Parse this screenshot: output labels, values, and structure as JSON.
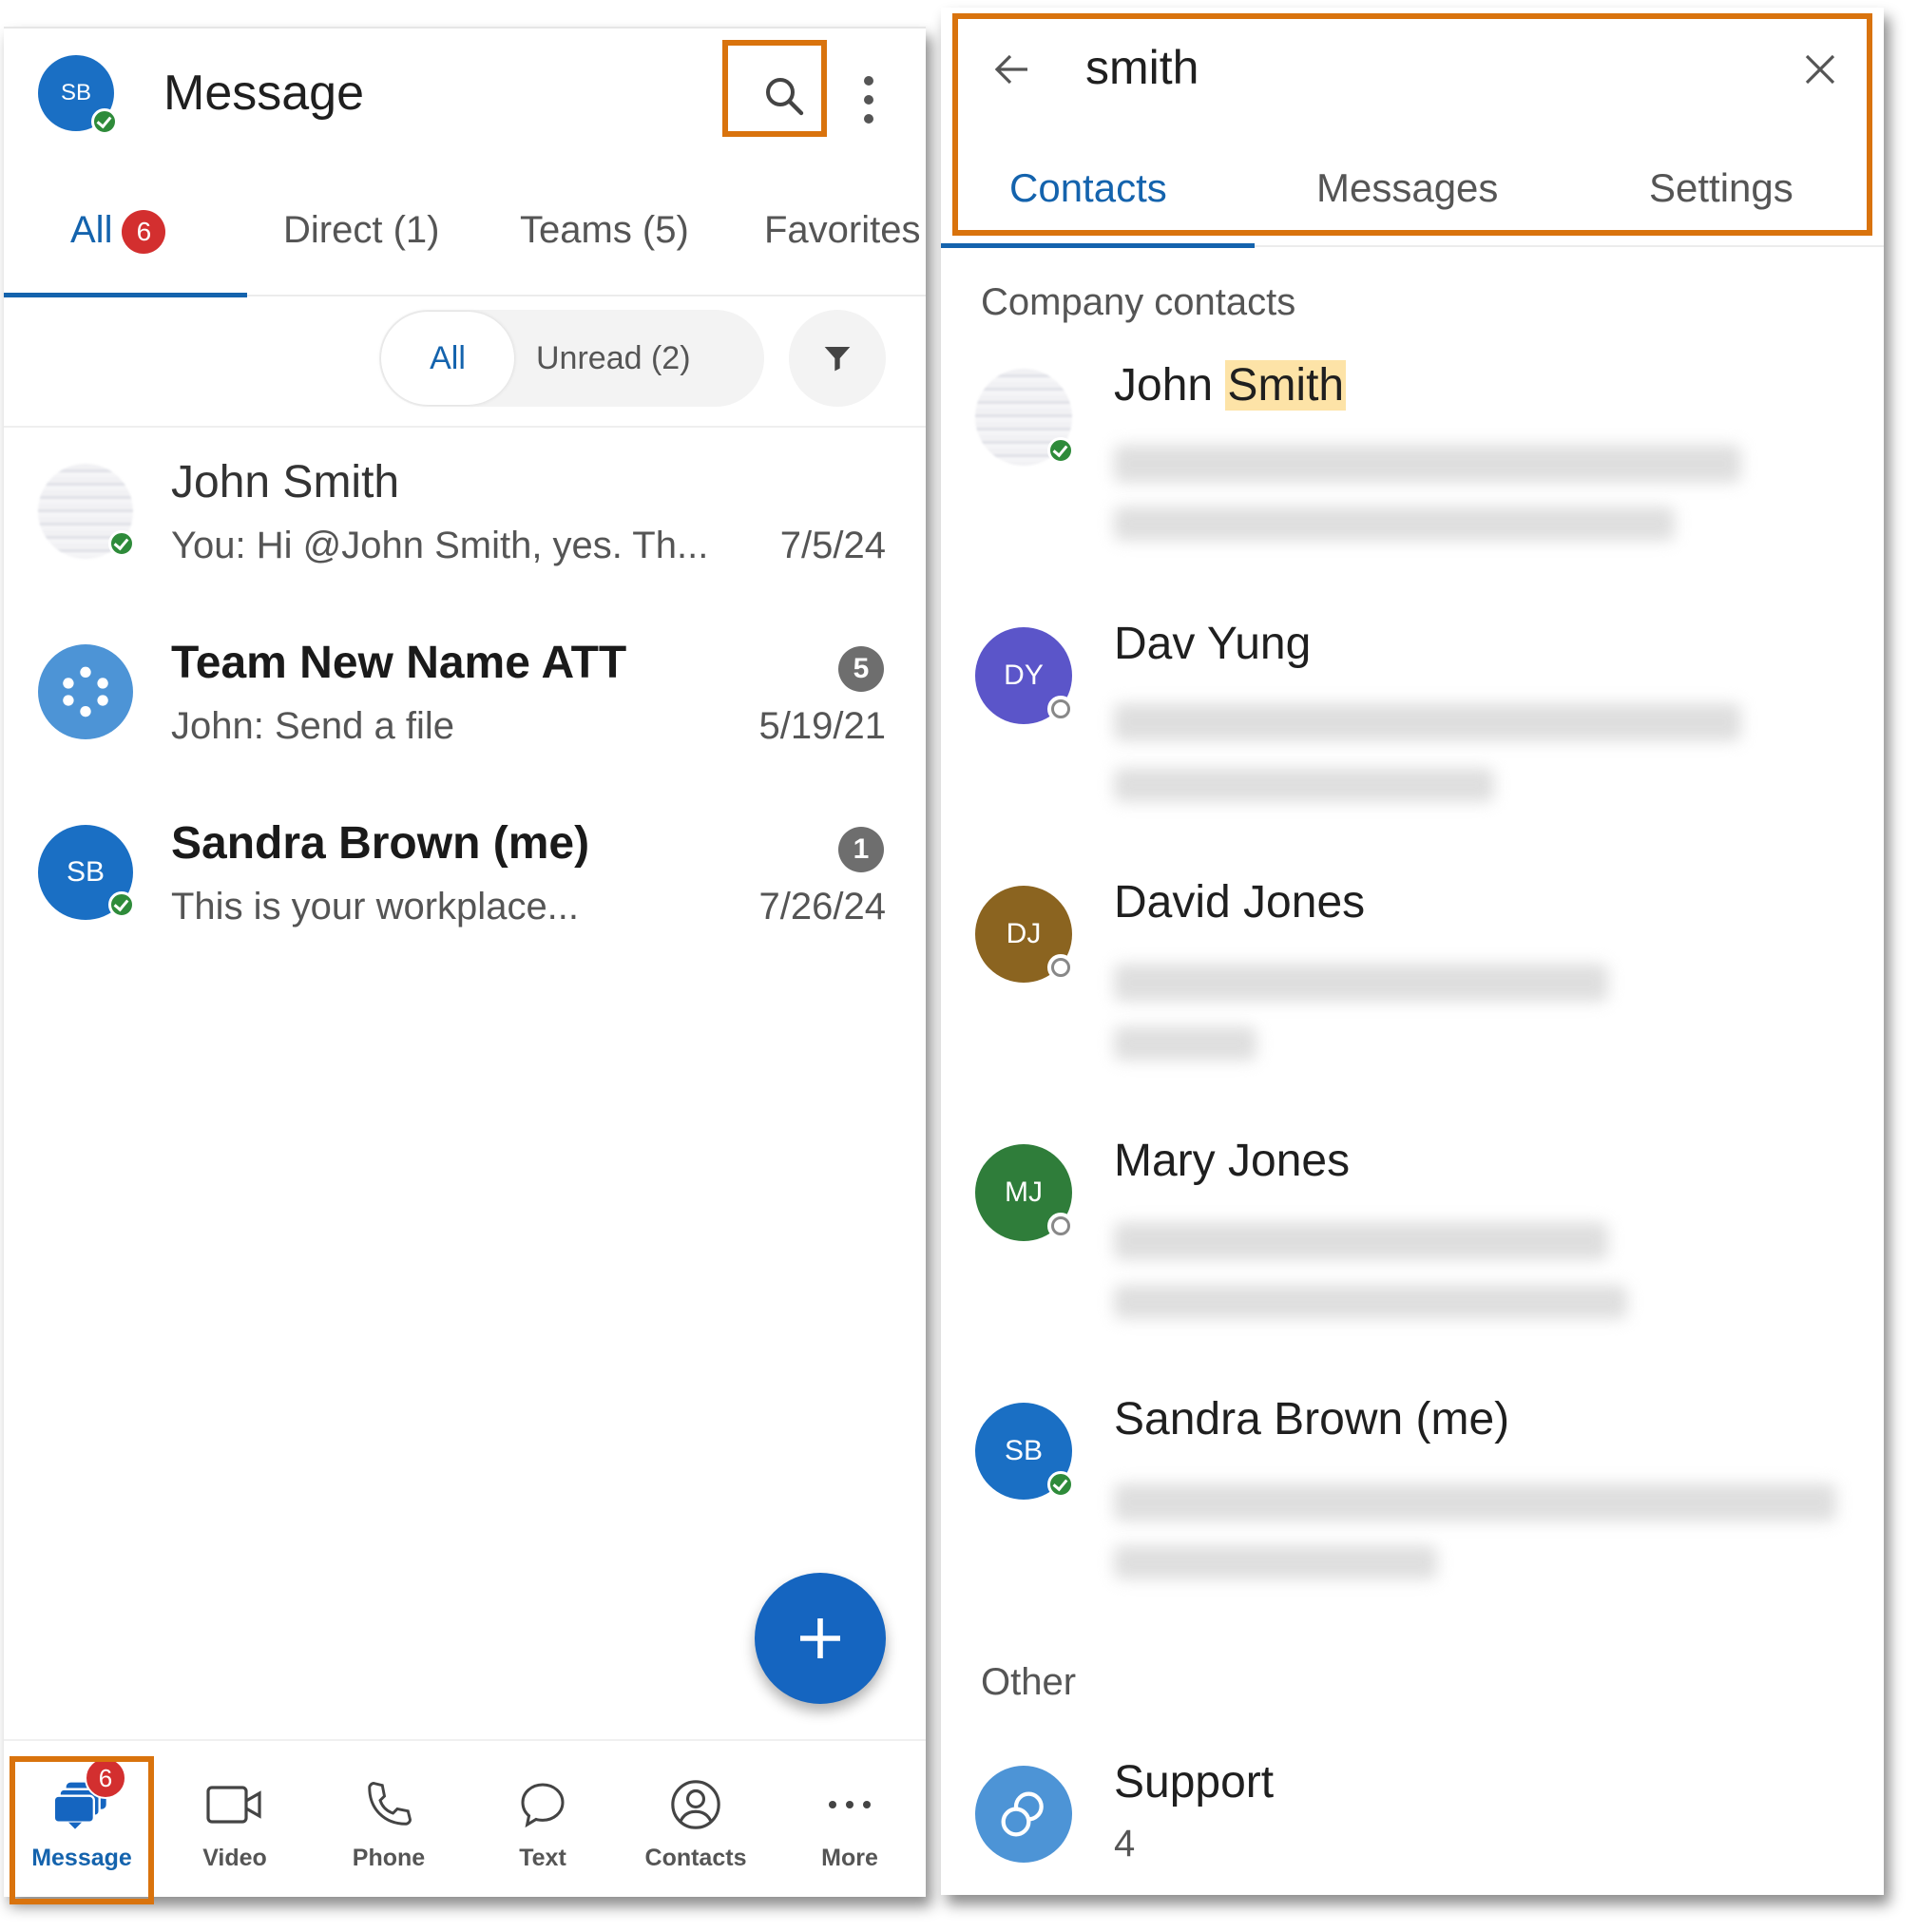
{
  "left_panel": {
    "user_avatar_initials": "SB",
    "title": "Message",
    "tabs": [
      {
        "label": "All",
        "badge": "6",
        "active": true
      },
      {
        "label": "Direct (1)"
      },
      {
        "label": "Teams (5)"
      },
      {
        "label": "Favorites"
      }
    ],
    "filter": {
      "all_label": "All",
      "unread_label": "Unread (2)"
    },
    "conversations": [
      {
        "name": "John Smith",
        "preview": "You: Hi @John Smith, yes. Th...",
        "date": "7/5/24",
        "bold": false,
        "status": "online"
      },
      {
        "name": "Team New Name ATT",
        "preview": "John: Send a file",
        "date": "5/19/21",
        "unread": "5",
        "bold": true
      },
      {
        "name": "Sandra Brown (me)",
        "initials": "SB",
        "preview": "This is your workplace...",
        "date": "7/26/24",
        "unread": "1",
        "bold": true,
        "status": "online"
      }
    ],
    "bottom_nav": [
      {
        "label": "Message",
        "icon": "message-icon",
        "badge": "6",
        "active": true
      },
      {
        "label": "Video",
        "icon": "video-icon"
      },
      {
        "label": "Phone",
        "icon": "phone-icon"
      },
      {
        "label": "Text",
        "icon": "text-icon"
      },
      {
        "label": "Contacts",
        "icon": "contacts-icon"
      },
      {
        "label": "More",
        "icon": "more-icon"
      }
    ]
  },
  "right_panel": {
    "search_value": "smith",
    "tabs": [
      {
        "label": "Contacts",
        "active": true
      },
      {
        "label": "Messages"
      },
      {
        "label": "Settings"
      }
    ],
    "sections": {
      "company": "Company contacts",
      "other": "Other"
    },
    "contacts": [
      {
        "name_prefix": "John ",
        "name_highlight": "Smith",
        "status": "online"
      },
      {
        "name": "Dav Yung",
        "initials": "DY",
        "color": "#5b55c9",
        "status": "offline"
      },
      {
        "name": "David Jones",
        "initials": "DJ",
        "color": "#8b6420",
        "status": "offline"
      },
      {
        "name": "Mary Jones",
        "initials": "MJ",
        "color": "#2f7d3a",
        "status": "offline"
      },
      {
        "name": "Sandra Brown (me)",
        "initials": "SB",
        "color": "#1a6fc4",
        "status": "online"
      }
    ],
    "other": [
      {
        "name": "Support",
        "sub": "4"
      }
    ]
  },
  "colors": {
    "accent": "#1463ad",
    "highlight_box": "#D9730D",
    "badge_red": "#d32f2f",
    "fab": "#1565c0"
  }
}
